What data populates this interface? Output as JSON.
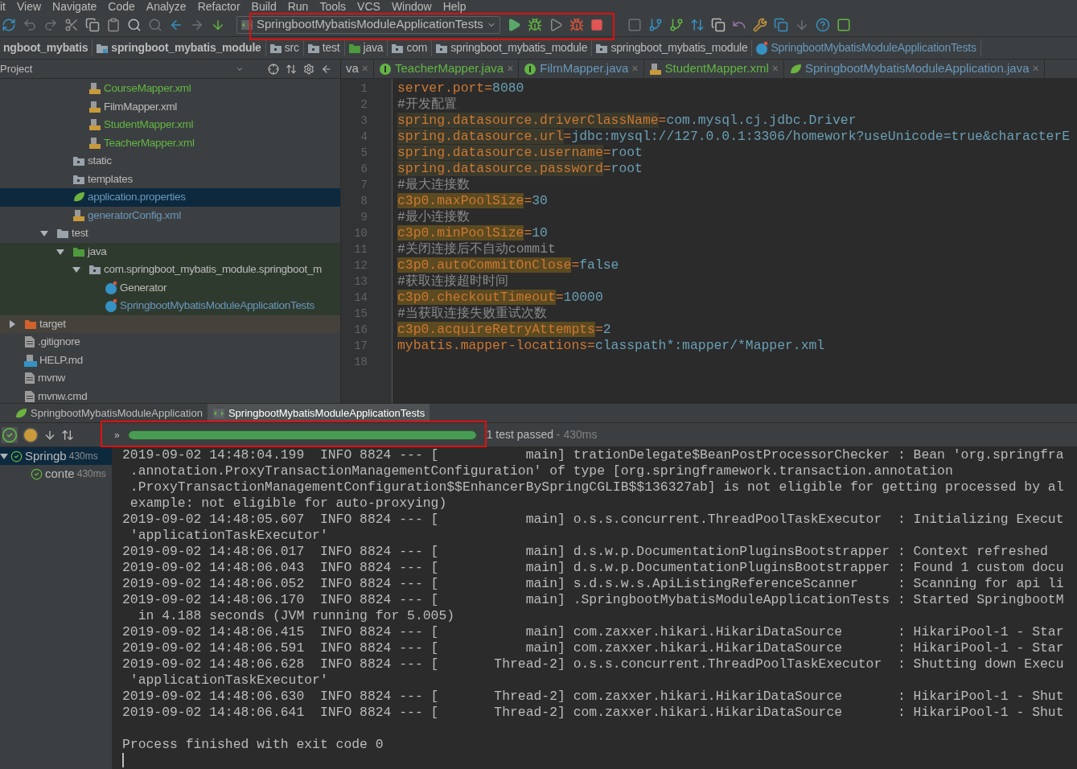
{
  "menu": [
    "it",
    "View",
    "Navigate",
    "Code",
    "Analyze",
    "Refactor",
    "Build",
    "Run",
    "Tools",
    "VCS",
    "Window",
    "Help"
  ],
  "run_config": "SpringbootMybatisModuleApplicationTests",
  "breadcrumb": [
    {
      "label": "ngboot_mybatis",
      "kind": "module",
      "bold": true
    },
    {
      "label": "springboot_mybatis_module",
      "kind": "module",
      "bold": true
    },
    {
      "label": "src",
      "kind": "folder",
      "bold": false
    },
    {
      "label": "test",
      "kind": "folder",
      "bold": false
    },
    {
      "label": "java",
      "kind": "source",
      "bold": false
    },
    {
      "label": "com",
      "kind": "package",
      "bold": false
    },
    {
      "label": "springboot_mybatis_module",
      "kind": "package",
      "bold": false
    },
    {
      "label": "springboot_mybatis_module",
      "kind": "package",
      "bold": false
    },
    {
      "label": "SpringbootMybatisModuleApplicationTests",
      "kind": "class",
      "bold": false
    }
  ],
  "project": {
    "title": "Project",
    "tree": [
      {
        "children": [
          {
            "children": [
              {
                "children": [
                  {
                    "children": [
                      {
                        "label": "CourseMapper.xml",
                        "kind": "xml",
                        "color": "#62b543",
                        "selected": false
                      },
                      {
                        "label": "FilmMapper.xml",
                        "kind": "xml",
                        "color": "#bbbbbb",
                        "selected": false
                      },
                      {
                        "label": "StudentMapper.xml",
                        "kind": "xml",
                        "color": "#62b543",
                        "selected": false
                      },
                      {
                        "label": "TeacherMapper.xml",
                        "kind": "xml",
                        "color": "#62b543",
                        "selected": false
                      }
                    ]
                  },
                  {
                    "label": "static",
                    "kind": "folder",
                    "color": "#bbbbbb",
                    "selected": false
                  },
                  {
                    "label": "templates",
                    "kind": "folder",
                    "color": "#bbbbbb",
                    "selected": false
                  },
                  {
                    "label": "application.properties",
                    "kind": "spring",
                    "color": "#6897bb",
                    "selected": true
                  },
                  {
                    "label": "generatorConfig.xml",
                    "kind": "xml",
                    "color": "#6897bb",
                    "selected": false
                  }
                ]
              },
              {
                "label": "test",
                "kind": "folder-plain",
                "color": "#bbbbbb",
                "selected": false,
                "expanded": true,
                "children": [
                  {
                    "label": "java",
                    "kind": "source",
                    "color": "#bbbbbb",
                    "selected": false,
                    "expanded": true,
                    "children": [
                      {
                        "label": "com.springboot_mybatis_module.springboot_m",
                        "kind": "folder",
                        "color": "#bbbbbb",
                        "selected": false,
                        "expanded": true,
                        "children": [
                          {
                            "label": "Generator",
                            "kind": "class",
                            "color": "#bbbbbb",
                            "selected": false
                          },
                          {
                            "label": "SpringbootMybatisModuleApplicationTests",
                            "kind": "class",
                            "color": "#6897bb",
                            "selected": false
                          }
                        ]
                      }
                    ]
                  }
                ]
              }
            ]
          }
        ]
      },
      {
        "label": "target",
        "kind": "excluded",
        "color": "#bbbbbb",
        "selected": false,
        "expanded": false
      },
      {
        "label": ".gitignore",
        "kind": "file",
        "color": "#bbbbbb",
        "selected": false
      },
      {
        "label": "HELP.md",
        "kind": "md",
        "color": "#bbbbbb",
        "selected": false
      },
      {
        "label": "mvnw",
        "kind": "file",
        "color": "#bbbbbb",
        "selected": false
      },
      {
        "label": "mvnw.cmd",
        "kind": "file",
        "color": "#bbbbbb",
        "selected": false
      }
    ]
  },
  "editor_tabs": [
    {
      "label": "va",
      "kind": "none",
      "color": "#bbbbbb",
      "close": "×"
    },
    {
      "label": "TeacherMapper.java",
      "kind": "interface",
      "color": "#62b543",
      "close": "×"
    },
    {
      "label": "FilmMapper.java",
      "kind": "interface",
      "color": "#6897bb",
      "close": "×"
    },
    {
      "label": "StudentMapper.xml",
      "kind": "xml",
      "color": "#62b543",
      "close": "×"
    },
    {
      "label": "SpringbootMybatisModuleApplication.java",
      "kind": "spring",
      "color": "#6897bb",
      "close": "×"
    }
  ],
  "editor_lines": [
    {
      "number": "1",
      "kind": "property",
      "key": "server.port",
      "sep": "=",
      "value": "8080"
    },
    {
      "number": "2",
      "kind": "comment",
      "text": "#开发配置"
    },
    {
      "number": "3",
      "kind": "flagged",
      "key": "spring.datasource.driverClassName",
      "sep": "=",
      "value": "com.mysql.cj.jdbc.Driver"
    },
    {
      "number": "4",
      "kind": "flagged",
      "key": "spring.datasource.url",
      "sep": "=",
      "value": "jdbc:mysql://127.0.0.1:3306/homework?useUnicode=true&characterE"
    },
    {
      "number": "5",
      "kind": "flagged",
      "key": "spring.datasource.username",
      "sep": "=",
      "value": "root"
    },
    {
      "number": "6",
      "kind": "flagged",
      "key": "spring.datasource.password",
      "sep": "=",
      "value": "root"
    },
    {
      "number": "7",
      "kind": "comment",
      "text": "#最大连接数"
    },
    {
      "number": "8",
      "kind": "unknown",
      "key": "c3p0.maxPoolSize",
      "sep": "=",
      "value": "30"
    },
    {
      "number": "9",
      "kind": "comment",
      "text": "#最小连接数"
    },
    {
      "number": "10",
      "kind": "unknown",
      "key": "c3p0.minPoolSize",
      "sep": "=",
      "value": "10"
    },
    {
      "number": "11",
      "kind": "comment",
      "text": "#关闭连接后不自动commit"
    },
    {
      "number": "12",
      "kind": "unknown",
      "key": "c3p0.autoCommitOnClose",
      "sep": "=",
      "value": "false"
    },
    {
      "number": "13",
      "kind": "comment",
      "text": "#获取连接超时时间"
    },
    {
      "number": "14",
      "kind": "unknown",
      "key": "c3p0.checkoutTimeout",
      "sep": "=",
      "value": "10000"
    },
    {
      "number": "15",
      "kind": "comment",
      "text": "#当获取连接失败重试次数"
    },
    {
      "number": "16",
      "kind": "unknown",
      "key": "c3p0.acquireRetryAttempts",
      "sep": "=",
      "value": "2"
    },
    {
      "number": "17",
      "kind": "property",
      "key": "mybatis.mapper-locations",
      "sep": "=",
      "value": "classpath*:mapper/*Mapper.xml"
    },
    {
      "number": "18",
      "kind": "empty"
    }
  ],
  "run_tabs": [
    {
      "label": "SpringbootMybatisModuleApplication",
      "kind": "spring",
      "selected": false
    },
    {
      "label": "SpringbootMybatisModuleApplicationTests",
      "kind": "test",
      "selected": true
    }
  ],
  "progress": {
    "level": 1,
    "status": "1 test passed",
    "time": " - 430ms",
    "expand": "»"
  },
  "test_tree": [
    {
      "label": "Springb",
      "time": "430ms",
      "passed": true,
      "children": [
        {
          "label": "conte",
          "time": "430ms",
          "passed": true
        }
      ]
    }
  ],
  "console": {
    "lines": [
      "2019-09-02 14:48:04.199  INFO 8824 --- [           main] trationDelegate$BeanPostProcessorChecker : Bean 'org.springfra",
      " .annotation.ProxyTransactionManagementConfiguration' of type [org.springframework.transaction.annotation",
      " .ProxyTransactionManagementConfiguration$$EnhancerBySpringCGLIB$$136327ab] is not eligible for getting processed by al",
      " example: not eligible for auto-proxying)",
      "2019-09-02 14:48:05.607  INFO 8824 --- [           main] o.s.s.concurrent.ThreadPoolTaskExecutor  : Initializing Execut",
      " 'applicationTaskExecutor'",
      "2019-09-02 14:48:06.017  INFO 8824 --- [           main] d.s.w.p.DocumentationPluginsBootstrapper : Context refreshed",
      "2019-09-02 14:48:06.043  INFO 8824 --- [           main] d.s.w.p.DocumentationPluginsBootstrapper : Found 1 custom docu",
      "2019-09-02 14:48:06.052  INFO 8824 --- [           main] s.d.s.w.s.ApiListingReferenceScanner     : Scanning for api li",
      "2019-09-02 14:48:06.170  INFO 8824 --- [           main] .SpringbootMybatisModuleApplicationTests : Started SpringbootM",
      "  in 4.188 seconds (JVM running for 5.005)",
      "2019-09-02 14:48:06.415  INFO 8824 --- [           main] com.zaxxer.hikari.HikariDataSource       : HikariPool-1 - Star",
      "2019-09-02 14:48:06.591  INFO 8824 --- [           main] com.zaxxer.hikari.HikariDataSource       : HikariPool-1 - Star",
      "2019-09-02 14:48:06.628  INFO 8824 --- [       Thread-2] o.s.s.concurrent.ThreadPoolTaskExecutor  : Shutting down Execu",
      " 'applicationTaskExecutor'",
      "2019-09-02 14:48:06.630  INFO 8824 --- [       Thread-2] com.zaxxer.hikari.HikariDataSource       : HikariPool-1 - Shut",
      "2019-09-02 14:48:06.641  INFO 8824 --- [       Thread-2] com.zaxxer.hikari.HikariDataSource       : HikariPool-1 - Shut"
    ],
    "exit_message": "Process finished with exit code 0"
  }
}
